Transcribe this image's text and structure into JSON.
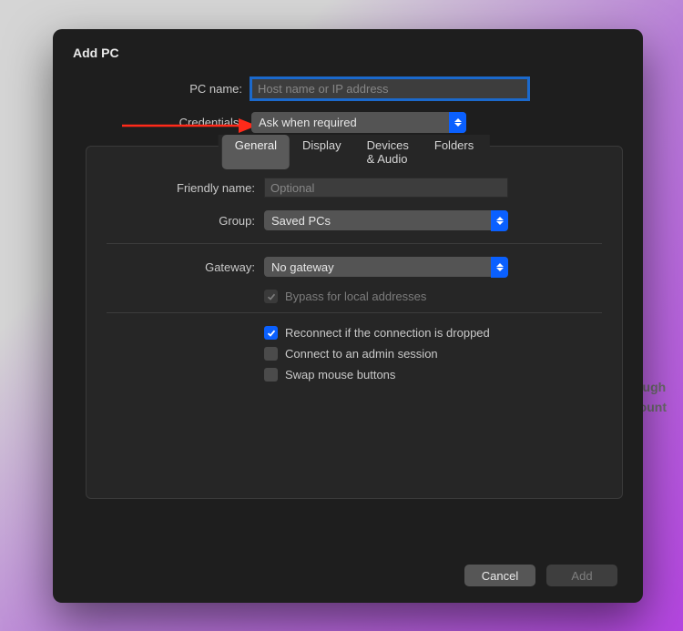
{
  "dialog": {
    "title": "Add PC"
  },
  "fields": {
    "pc_name_label": "PC name:",
    "pc_name_placeholder": "Host name or IP address",
    "credentials_label": "Credentials:",
    "credentials_value": "Ask when required"
  },
  "tabs": {
    "general": "General",
    "display": "Display",
    "devices": "Devices & Audio",
    "folders": "Folders"
  },
  "general": {
    "friendly_label": "Friendly name:",
    "friendly_placeholder": "Optional",
    "group_label": "Group:",
    "group_value": "Saved PCs",
    "gateway_label": "Gateway:",
    "gateway_value": "No gateway",
    "bypass_label": "Bypass for local addresses",
    "reconnect_label": "Reconnect if the connection is dropped",
    "admin_label": "Connect to an admin session",
    "swap_label": "Swap mouse buttons"
  },
  "footer": {
    "cancel": "Cancel",
    "add": "Add"
  },
  "background_hints": {
    "line1": "through",
    "line2": "account"
  }
}
